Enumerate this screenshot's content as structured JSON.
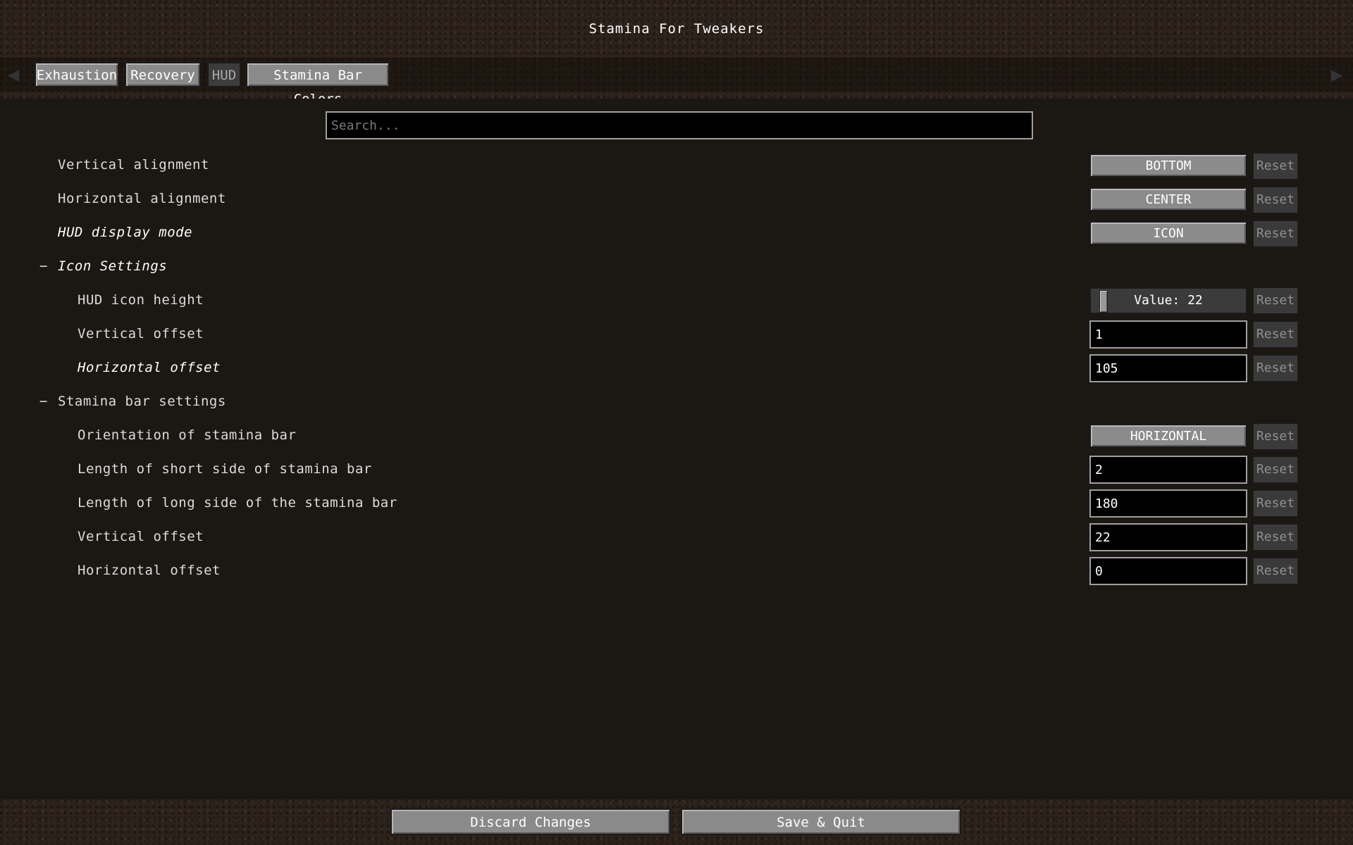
{
  "window": {
    "title": "Stamina For Tweakers"
  },
  "tabs": [
    {
      "label": "Exhaustion"
    },
    {
      "label": "Recovery"
    },
    {
      "label": "HUD"
    },
    {
      "label": "Stamina Bar Colors"
    }
  ],
  "search": {
    "placeholder": "Search..."
  },
  "collapse_symbol": "−",
  "reset_label": "Reset",
  "settings": {
    "vertical_alignment": {
      "label": "Vertical alignment",
      "value": "BOTTOM"
    },
    "horizontal_alignment": {
      "label": "Horizontal alignment",
      "value": "CENTER"
    },
    "hud_display_mode": {
      "label": "HUD display mode",
      "value": "ICON"
    },
    "icon_settings": {
      "label": "Icon Settings",
      "hud_icon_height": {
        "label": "HUD icon height",
        "value_text": "Value: 22"
      },
      "vertical_offset": {
        "label": "Vertical offset",
        "value": "1"
      },
      "horizontal_offset": {
        "label": "Horizontal offset",
        "value": "105"
      }
    },
    "stamina_bar_settings": {
      "label": "Stamina bar settings",
      "orientation": {
        "label": "Orientation of stamina bar",
        "value": "HORIZONTAL"
      },
      "short_side": {
        "label": "Length of short side of stamina bar",
        "value": "2"
      },
      "long_side": {
        "label": "Length of long side of the stamina bar",
        "value": "180"
      },
      "vertical_offset": {
        "label": "Vertical offset",
        "value": "22"
      },
      "horizontal_offset": {
        "label": "Horizontal offset",
        "value": "0"
      }
    }
  },
  "footer": {
    "discard_label": "Discard Changes",
    "save_label": "Save & Quit"
  }
}
